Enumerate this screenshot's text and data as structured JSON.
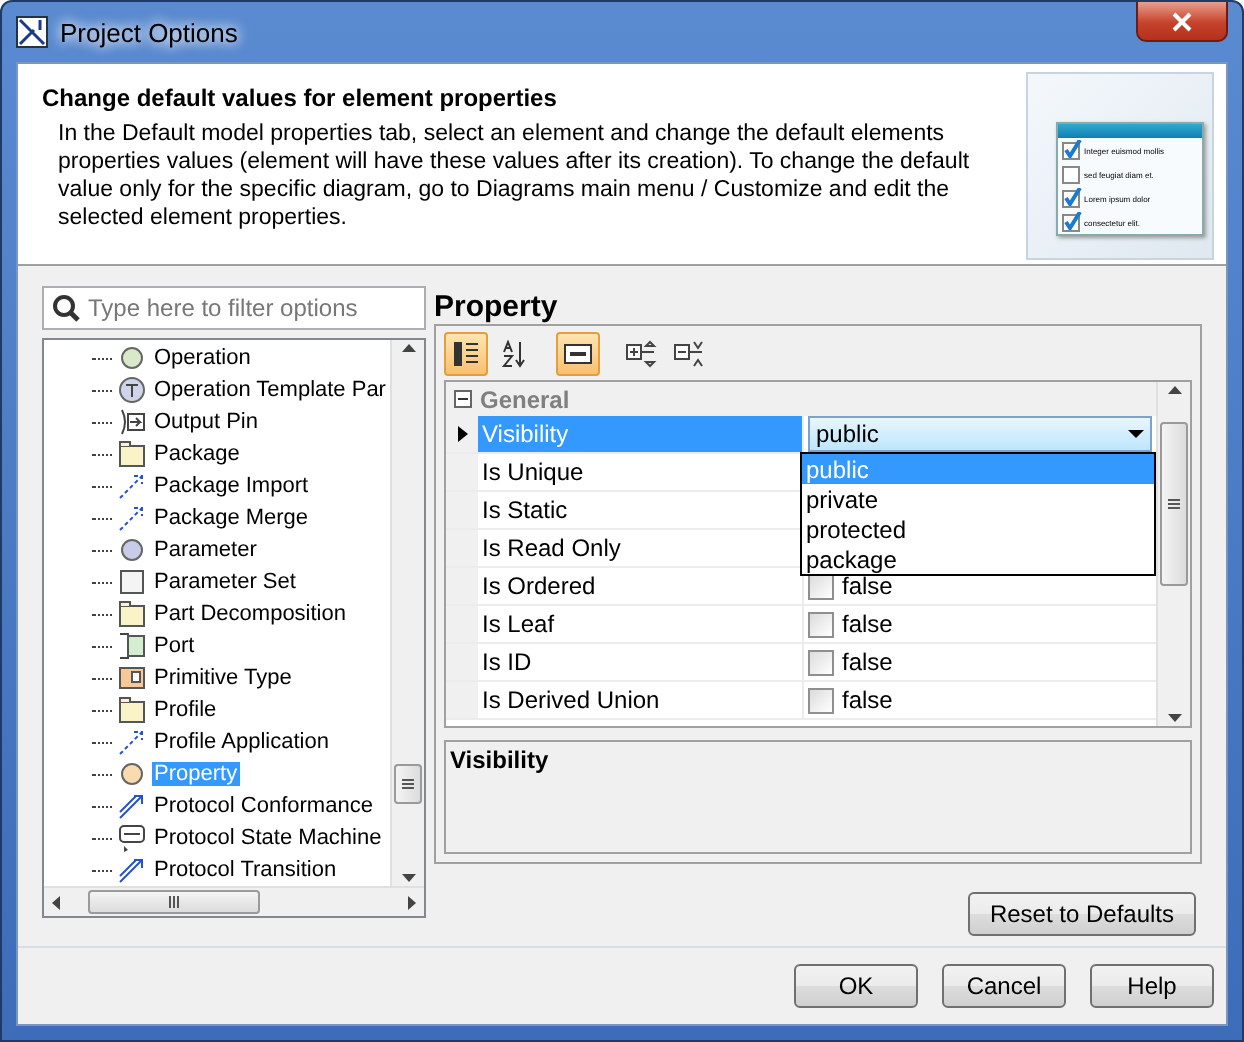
{
  "window": {
    "title": "Project Options"
  },
  "banner": {
    "heading": "Change default values for element properties",
    "text": "In the Default model properties tab, select an element and change the default elements properties values (element will have these values after its creation). To change the default value only for the specific diagram, go to Diagrams main menu / Customize and edit the selected element properties.",
    "illustration": [
      {
        "label": "Integer euismod mollis",
        "checked": true
      },
      {
        "label": "sed feugiat diam et.",
        "checked": false
      },
      {
        "label": "Lorem ipsum dolor",
        "checked": true
      },
      {
        "label": "consectetur elit.",
        "checked": true
      }
    ]
  },
  "search": {
    "placeholder": "Type here to filter options"
  },
  "tree": [
    {
      "label": "Operation",
      "kind": "circle",
      "color": "#d8e8c8",
      "selected": false
    },
    {
      "label": "Operation Template Par",
      "kind": "template",
      "selected": false
    },
    {
      "label": "Output Pin",
      "kind": "pin",
      "selected": false
    },
    {
      "label": "Package",
      "kind": "folder",
      "selected": false
    },
    {
      "label": "Package Import",
      "kind": "dashed",
      "selected": false
    },
    {
      "label": "Package Merge",
      "kind": "dashed",
      "selected": false
    },
    {
      "label": "Parameter",
      "kind": "circle",
      "color": "#c8cce8",
      "selected": false
    },
    {
      "label": "Parameter Set",
      "kind": "square",
      "selected": false
    },
    {
      "label": "Part Decomposition",
      "kind": "folder",
      "selected": false
    },
    {
      "label": "Port",
      "kind": "port",
      "selected": false
    },
    {
      "label": "Primitive Type",
      "kind": "primitive",
      "selected": false
    },
    {
      "label": "Profile",
      "kind": "folder",
      "selected": false
    },
    {
      "label": "Profile Application",
      "kind": "dashed",
      "selected": false
    },
    {
      "label": "Property",
      "kind": "circle",
      "color": "#f8dcb0",
      "selected": true
    },
    {
      "label": "Protocol Conformance",
      "kind": "solid",
      "selected": false
    },
    {
      "label": "Protocol State Machine",
      "kind": "machine",
      "selected": false
    },
    {
      "label": "Protocol Transition",
      "kind": "solid",
      "selected": false
    }
  ],
  "property": {
    "title": "Property",
    "toolbar": [
      {
        "kind": "categorized",
        "selected": true
      },
      {
        "kind": "sort",
        "selected": false
      },
      {
        "kind": "description",
        "selected": true
      },
      {
        "kind": "expand",
        "selected": false
      },
      {
        "kind": "collapse",
        "selected": false
      }
    ],
    "group": {
      "label": "General",
      "expanded": true
    },
    "rows": [
      {
        "name": "Visibility",
        "kind": "combo",
        "value": "public",
        "selected": true
      },
      {
        "name": "Is Unique",
        "kind": "hidden",
        "selected": false
      },
      {
        "name": "Is Static",
        "kind": "hidden",
        "selected": false
      },
      {
        "name": "Is Read Only",
        "kind": "hidden",
        "selected": false
      },
      {
        "name": "Is Ordered",
        "kind": "check",
        "value": "false",
        "checked": false,
        "selected": false
      },
      {
        "name": "Is Leaf",
        "kind": "check",
        "value": "false",
        "checked": false,
        "selected": false
      },
      {
        "name": "Is ID",
        "kind": "check",
        "value": "false",
        "checked": false,
        "selected": false
      },
      {
        "name": "Is Derived Union",
        "kind": "check",
        "value": "false",
        "checked": false,
        "selected": false
      }
    ],
    "dropdown": [
      {
        "label": "public",
        "selected": true
      },
      {
        "label": "private",
        "selected": false
      },
      {
        "label": "protected",
        "selected": false
      },
      {
        "label": "package",
        "selected": false
      }
    ],
    "description_title": "Visibility",
    "reset": "Reset to Defaults"
  },
  "buttons": [
    "OK",
    "Cancel",
    "Help"
  ]
}
